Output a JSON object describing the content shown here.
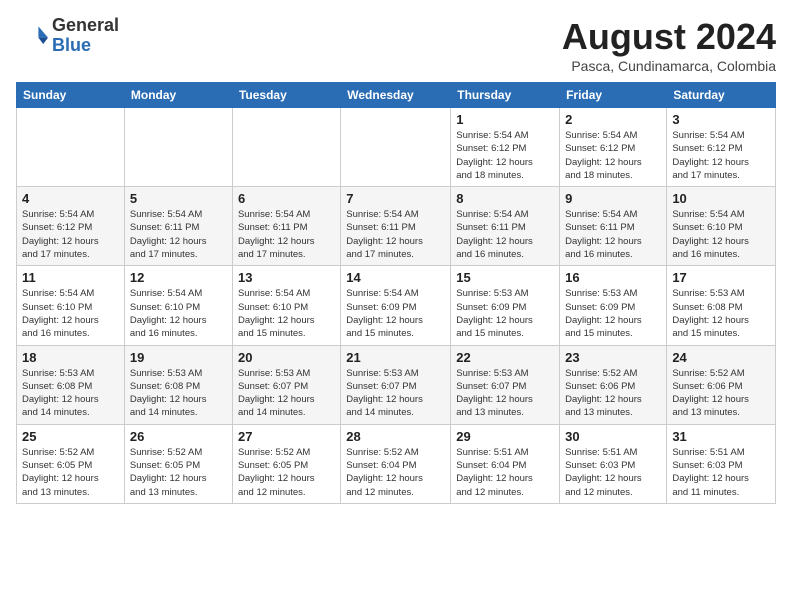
{
  "header": {
    "logo_general": "General",
    "logo_blue": "Blue",
    "month_title": "August 2024",
    "subtitle": "Pasca, Cundinamarca, Colombia"
  },
  "weekdays": [
    "Sunday",
    "Monday",
    "Tuesday",
    "Wednesday",
    "Thursday",
    "Friday",
    "Saturday"
  ],
  "weeks": [
    [
      {
        "day": "",
        "info": ""
      },
      {
        "day": "",
        "info": ""
      },
      {
        "day": "",
        "info": ""
      },
      {
        "day": "",
        "info": ""
      },
      {
        "day": "1",
        "info": "Sunrise: 5:54 AM\nSunset: 6:12 PM\nDaylight: 12 hours\nand 18 minutes."
      },
      {
        "day": "2",
        "info": "Sunrise: 5:54 AM\nSunset: 6:12 PM\nDaylight: 12 hours\nand 18 minutes."
      },
      {
        "day": "3",
        "info": "Sunrise: 5:54 AM\nSunset: 6:12 PM\nDaylight: 12 hours\nand 17 minutes."
      }
    ],
    [
      {
        "day": "4",
        "info": "Sunrise: 5:54 AM\nSunset: 6:12 PM\nDaylight: 12 hours\nand 17 minutes."
      },
      {
        "day": "5",
        "info": "Sunrise: 5:54 AM\nSunset: 6:11 PM\nDaylight: 12 hours\nand 17 minutes."
      },
      {
        "day": "6",
        "info": "Sunrise: 5:54 AM\nSunset: 6:11 PM\nDaylight: 12 hours\nand 17 minutes."
      },
      {
        "day": "7",
        "info": "Sunrise: 5:54 AM\nSunset: 6:11 PM\nDaylight: 12 hours\nand 17 minutes."
      },
      {
        "day": "8",
        "info": "Sunrise: 5:54 AM\nSunset: 6:11 PM\nDaylight: 12 hours\nand 16 minutes."
      },
      {
        "day": "9",
        "info": "Sunrise: 5:54 AM\nSunset: 6:11 PM\nDaylight: 12 hours\nand 16 minutes."
      },
      {
        "day": "10",
        "info": "Sunrise: 5:54 AM\nSunset: 6:10 PM\nDaylight: 12 hours\nand 16 minutes."
      }
    ],
    [
      {
        "day": "11",
        "info": "Sunrise: 5:54 AM\nSunset: 6:10 PM\nDaylight: 12 hours\nand 16 minutes."
      },
      {
        "day": "12",
        "info": "Sunrise: 5:54 AM\nSunset: 6:10 PM\nDaylight: 12 hours\nand 16 minutes."
      },
      {
        "day": "13",
        "info": "Sunrise: 5:54 AM\nSunset: 6:10 PM\nDaylight: 12 hours\nand 15 minutes."
      },
      {
        "day": "14",
        "info": "Sunrise: 5:54 AM\nSunset: 6:09 PM\nDaylight: 12 hours\nand 15 minutes."
      },
      {
        "day": "15",
        "info": "Sunrise: 5:53 AM\nSunset: 6:09 PM\nDaylight: 12 hours\nand 15 minutes."
      },
      {
        "day": "16",
        "info": "Sunrise: 5:53 AM\nSunset: 6:09 PM\nDaylight: 12 hours\nand 15 minutes."
      },
      {
        "day": "17",
        "info": "Sunrise: 5:53 AM\nSunset: 6:08 PM\nDaylight: 12 hours\nand 15 minutes."
      }
    ],
    [
      {
        "day": "18",
        "info": "Sunrise: 5:53 AM\nSunset: 6:08 PM\nDaylight: 12 hours\nand 14 minutes."
      },
      {
        "day": "19",
        "info": "Sunrise: 5:53 AM\nSunset: 6:08 PM\nDaylight: 12 hours\nand 14 minutes."
      },
      {
        "day": "20",
        "info": "Sunrise: 5:53 AM\nSunset: 6:07 PM\nDaylight: 12 hours\nand 14 minutes."
      },
      {
        "day": "21",
        "info": "Sunrise: 5:53 AM\nSunset: 6:07 PM\nDaylight: 12 hours\nand 14 minutes."
      },
      {
        "day": "22",
        "info": "Sunrise: 5:53 AM\nSunset: 6:07 PM\nDaylight: 12 hours\nand 13 minutes."
      },
      {
        "day": "23",
        "info": "Sunrise: 5:52 AM\nSunset: 6:06 PM\nDaylight: 12 hours\nand 13 minutes."
      },
      {
        "day": "24",
        "info": "Sunrise: 5:52 AM\nSunset: 6:06 PM\nDaylight: 12 hours\nand 13 minutes."
      }
    ],
    [
      {
        "day": "25",
        "info": "Sunrise: 5:52 AM\nSunset: 6:05 PM\nDaylight: 12 hours\nand 13 minutes."
      },
      {
        "day": "26",
        "info": "Sunrise: 5:52 AM\nSunset: 6:05 PM\nDaylight: 12 hours\nand 13 minutes."
      },
      {
        "day": "27",
        "info": "Sunrise: 5:52 AM\nSunset: 6:05 PM\nDaylight: 12 hours\nand 12 minutes."
      },
      {
        "day": "28",
        "info": "Sunrise: 5:52 AM\nSunset: 6:04 PM\nDaylight: 12 hours\nand 12 minutes."
      },
      {
        "day": "29",
        "info": "Sunrise: 5:51 AM\nSunset: 6:04 PM\nDaylight: 12 hours\nand 12 minutes."
      },
      {
        "day": "30",
        "info": "Sunrise: 5:51 AM\nSunset: 6:03 PM\nDaylight: 12 hours\nand 12 minutes."
      },
      {
        "day": "31",
        "info": "Sunrise: 5:51 AM\nSunset: 6:03 PM\nDaylight: 12 hours\nand 11 minutes."
      }
    ]
  ]
}
